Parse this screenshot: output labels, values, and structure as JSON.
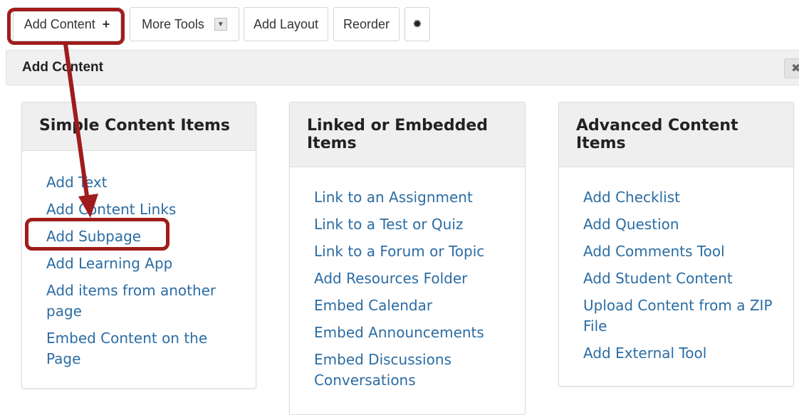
{
  "toolbar": {
    "add_content": "Add Content",
    "add_content_plus": "+",
    "more_tools": "More Tools",
    "more_tools_arrow": "▼",
    "add_layout": "Add Layout",
    "reorder": "Reorder",
    "settings_icon": "✹"
  },
  "header": {
    "title": "Add Content",
    "close": "✖"
  },
  "panels": {
    "simple": {
      "title": "Simple Content Items",
      "items": [
        "Add Text",
        "Add Content Links",
        "Add Subpage",
        "Add Learning App",
        "Add items from another page",
        "Embed Content on the Page"
      ]
    },
    "linked": {
      "title": "Linked or Embedded Items",
      "items": [
        "Link to an Assignment",
        "Link to a Test or Quiz",
        "Link to a Forum or Topic",
        "Add Resources Folder",
        "Embed Calendar",
        "Embed Announcements",
        "Embed Discussions Conversations"
      ]
    },
    "advanced": {
      "title": "Advanced Content Items",
      "items": [
        "Add Checklist",
        "Add Question",
        "Add Comments Tool",
        "Add Student Content",
        "Upload Content from a ZIP File",
        "Add External Tool"
      ]
    }
  },
  "colors": {
    "link": "#2b6ca3",
    "callout": "#a01c1c"
  }
}
